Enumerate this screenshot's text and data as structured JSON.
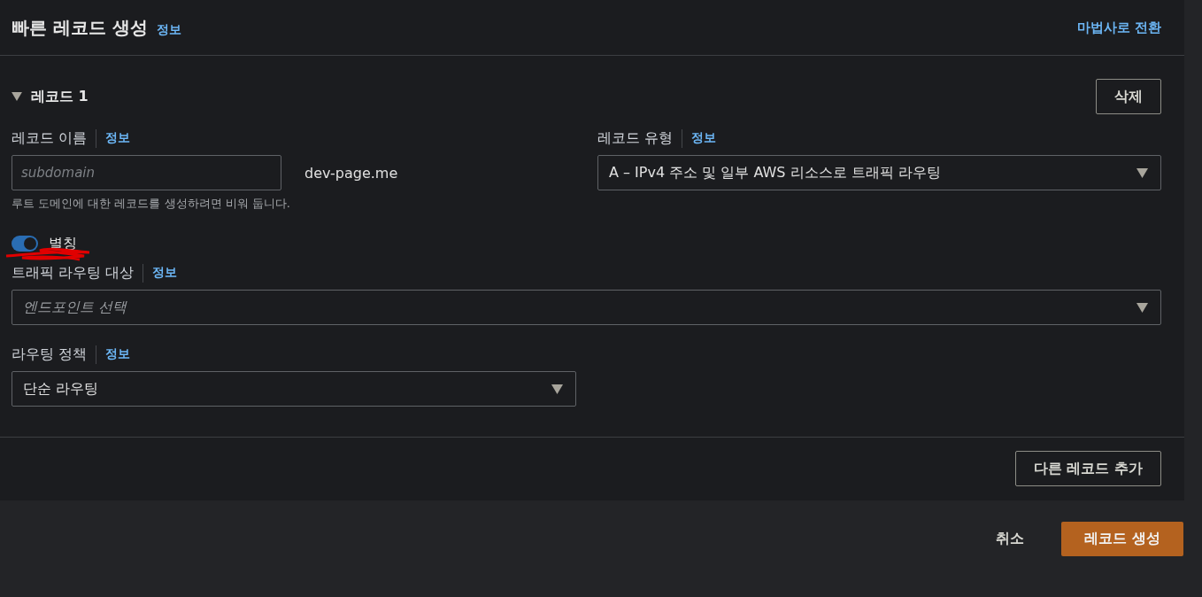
{
  "header": {
    "title": "빠른 레코드 생성",
    "info": "정보",
    "wizard_link": "마법사로 전환"
  },
  "record": {
    "title": "레코드 1",
    "expanded": true,
    "delete_button": "삭제",
    "record_name": {
      "label": "레코드 이름",
      "info": "정보",
      "placeholder": "subdomain",
      "suffix": "dev-page.me",
      "hint": "루트 도메인에 대한 레코드를 생성하려면 비워 둡니다."
    },
    "record_type": {
      "label": "레코드 유형",
      "info": "정보",
      "value": "A – IPv4 주소 및 일부 AWS 리소스로 트래픽 라우팅"
    },
    "alias": {
      "label": "별칭",
      "on": true
    },
    "route_target": {
      "label": "트래픽 라우팅 대상",
      "info": "정보",
      "placeholder": "엔드포인트 선택"
    },
    "routing_policy": {
      "label": "라우팅 정책",
      "info": "정보",
      "value": "단순 라우팅"
    }
  },
  "add_record_button": "다른 레코드 추가",
  "footer": {
    "cancel": "취소",
    "create": "레코드 생성"
  }
}
